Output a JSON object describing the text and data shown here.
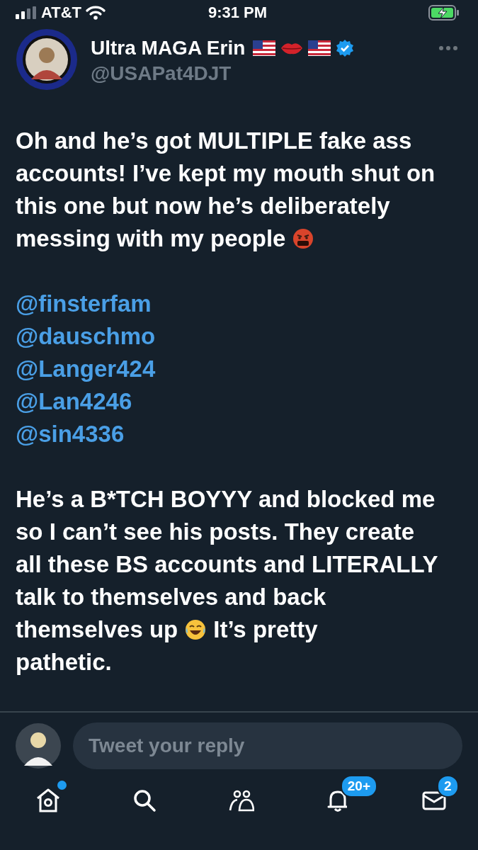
{
  "status_bar": {
    "carrier": "AT&T",
    "time": "9:31 PM"
  },
  "tweet": {
    "author_name": "Ultra MAGA Erin",
    "handle": "@USAPat4DJT",
    "paragraphs": [
      [
        [
          {
            "kind": "text",
            "text": "Oh and he’s got MULTIPLE fake ass"
          }
        ],
        [
          {
            "kind": "text",
            "text": "accounts! I’ve kept my mouth shut on"
          }
        ],
        [
          {
            "kind": "text",
            "text": "this one but now he’s deliberately"
          }
        ],
        [
          {
            "kind": "text",
            "text": "messing with my people"
          },
          {
            "kind": "rage"
          }
        ]
      ],
      [
        [
          {
            "kind": "text",
            "text": "He’s a B*TCH BOYYY and blocked me"
          }
        ],
        [
          {
            "kind": "text",
            "text": "so I can’t see his posts. They create"
          }
        ],
        [
          {
            "kind": "text",
            "text": "all these BS accounts and LITERALLY"
          }
        ],
        [
          {
            "kind": "text",
            "text": "talk to themselves and back"
          }
        ],
        [
          {
            "kind": "text",
            "text": "themselves up"
          },
          {
            "kind": "laugh"
          },
          {
            "kind": "text",
            "text": "It’s pretty"
          }
        ],
        [
          {
            "kind": "text",
            "text": "pathetic."
          }
        ]
      ]
    ],
    "mentions": [
      "@finsterfam",
      "@dauschmo",
      "@Langer424",
      "@Lan4246",
      "@sin4336"
    ]
  },
  "reply": {
    "placeholder": "Tweet your reply"
  },
  "nav": [
    {
      "kind": "home",
      "unread": true
    },
    {
      "kind": "search",
      "unread": false
    },
    {
      "kind": "people",
      "unread": false
    },
    {
      "kind": "bell",
      "unread": false,
      "badge": "20+"
    },
    {
      "kind": "mail",
      "unread": false,
      "badge": "2"
    }
  ]
}
